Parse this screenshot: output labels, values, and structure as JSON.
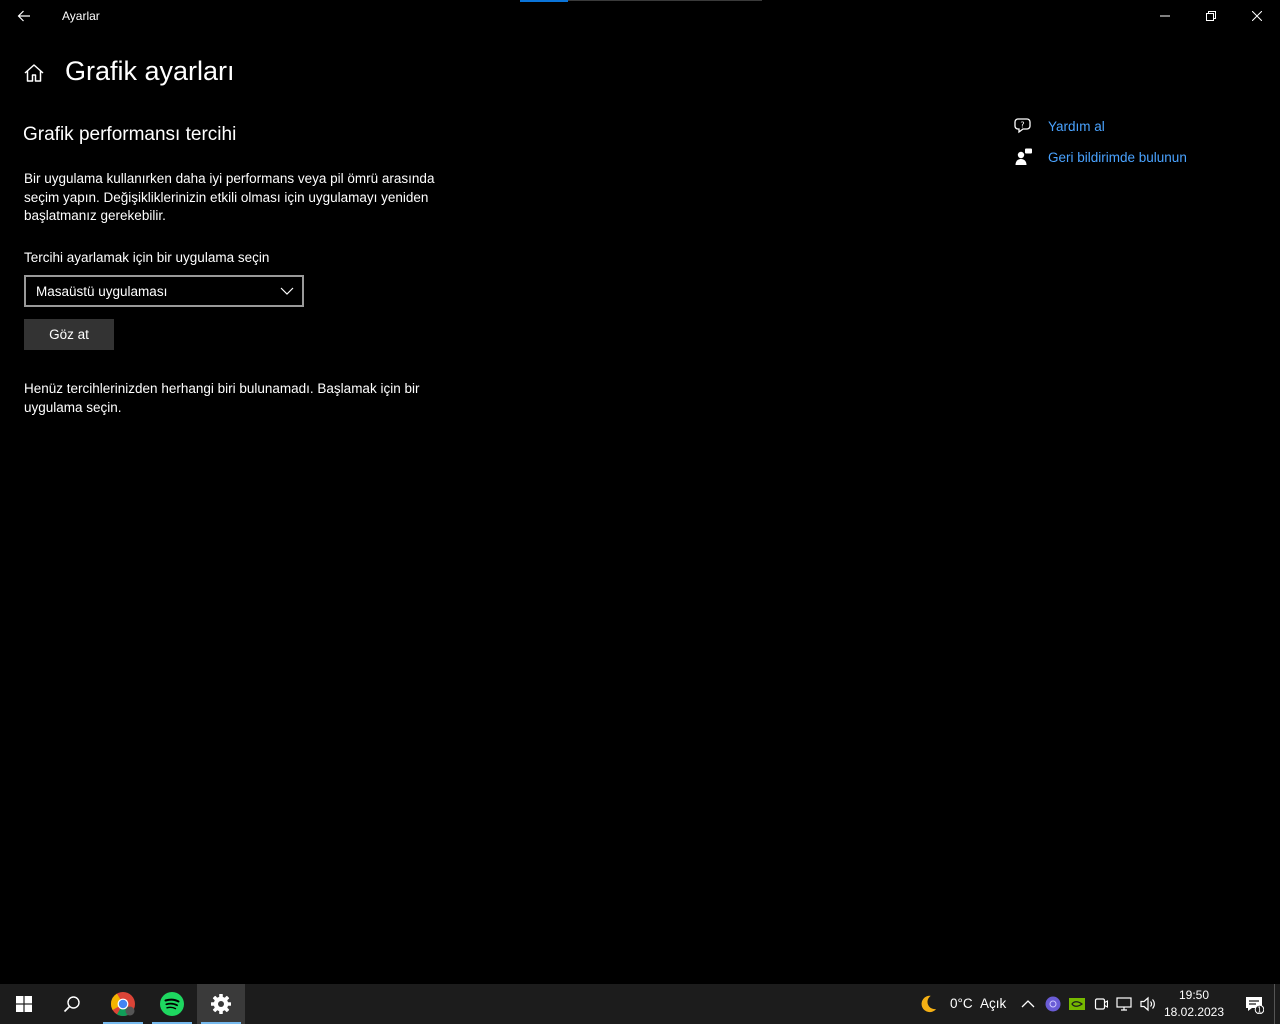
{
  "window": {
    "title": "Ayarlar",
    "loading_progress_percent": 20
  },
  "header": {
    "title": "Grafik ayarları"
  },
  "main": {
    "section_title": "Grafik performansı tercihi",
    "description": "Bir uygulama kullanırken daha iyi performans veya pil ömrü arasında seçim yapın. Değişikliklerinizin etkili olması için uygulamayı yeniden başlatmanız gerekebilir.",
    "select_label": "Tercihi ayarlamak için bir uygulama seçin",
    "dropdown_value": "Masaüstü uygulaması",
    "browse_label": "Göz at",
    "empty_message": "Henüz tercihlerinizden herhangi biri bulunamadı. Başlamak için bir uygulama seçin."
  },
  "side_links": [
    {
      "label": "Yardım al",
      "icon": "help-chat-icon"
    },
    {
      "label": "Geri bildirimde bulunun",
      "icon": "feedback-icon"
    }
  ],
  "taskbar": {
    "apps": [
      {
        "name": "Chrome",
        "icon": "chrome-icon"
      },
      {
        "name": "Spotify",
        "icon": "spotify-icon"
      },
      {
        "name": "Ayarlar",
        "icon": "settings-gear-icon"
      }
    ],
    "weather": {
      "temp": "0°C",
      "condition": "Açık",
      "icon": "moon-icon"
    },
    "clock": {
      "time": "19:50",
      "date": "18.02.2023"
    },
    "notification_count": "1"
  },
  "colors": {
    "accent": "#0a74d9",
    "link": "#4aa3ff",
    "background": "#000000",
    "taskbar": "#1c1c1c",
    "spotify": "#1ed760"
  }
}
